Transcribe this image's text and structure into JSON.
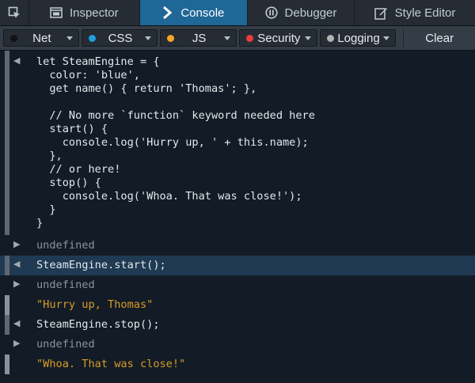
{
  "toolbar": {
    "tabs": [
      {
        "label": "Inspector",
        "icon": "inspector-icon"
      },
      {
        "label": "Console",
        "icon": "console-icon",
        "active": true
      },
      {
        "label": "Debugger",
        "icon": "pause-icon"
      },
      {
        "label": "Style Editor",
        "icon": "pencil-icon"
      }
    ]
  },
  "filters": {
    "items": [
      {
        "label": "Net",
        "color": "#1a1a1a"
      },
      {
        "label": "CSS",
        "color": "#1e9fe0"
      },
      {
        "label": "JS",
        "color": "#f6a623"
      },
      {
        "label": "Security",
        "color": "#ee3b3b"
      },
      {
        "label": "Logging",
        "color": "#b2b2b2"
      }
    ],
    "clear_label": "Clear"
  },
  "console": {
    "entries": [
      {
        "kind": "input",
        "text": "let SteamEngine = {\n  color: 'blue',\n  get name() { return 'Thomas'; },\n\n  // No more `function` keyword needed here\n  start() {\n    console.log('Hurry up, ' + this.name);\n  },\n  // or here!\n  stop() {\n    console.log('Whoa. That was close!');\n  }\n}"
      },
      {
        "kind": "result",
        "text": "undefined"
      },
      {
        "kind": "input",
        "text": "SteamEngine.start();",
        "highlighted": true
      },
      {
        "kind": "result",
        "text": "undefined"
      },
      {
        "kind": "log",
        "text": "\"Hurry up, Thomas\""
      },
      {
        "kind": "input",
        "text": "SteamEngine.stop();"
      },
      {
        "kind": "result",
        "text": "undefined"
      },
      {
        "kind": "log",
        "text": "\"Whoa. That was close!\""
      }
    ]
  },
  "colors": {
    "accent": "#1f6797",
    "string": "#d99b28",
    "muted": "#8a949d"
  }
}
